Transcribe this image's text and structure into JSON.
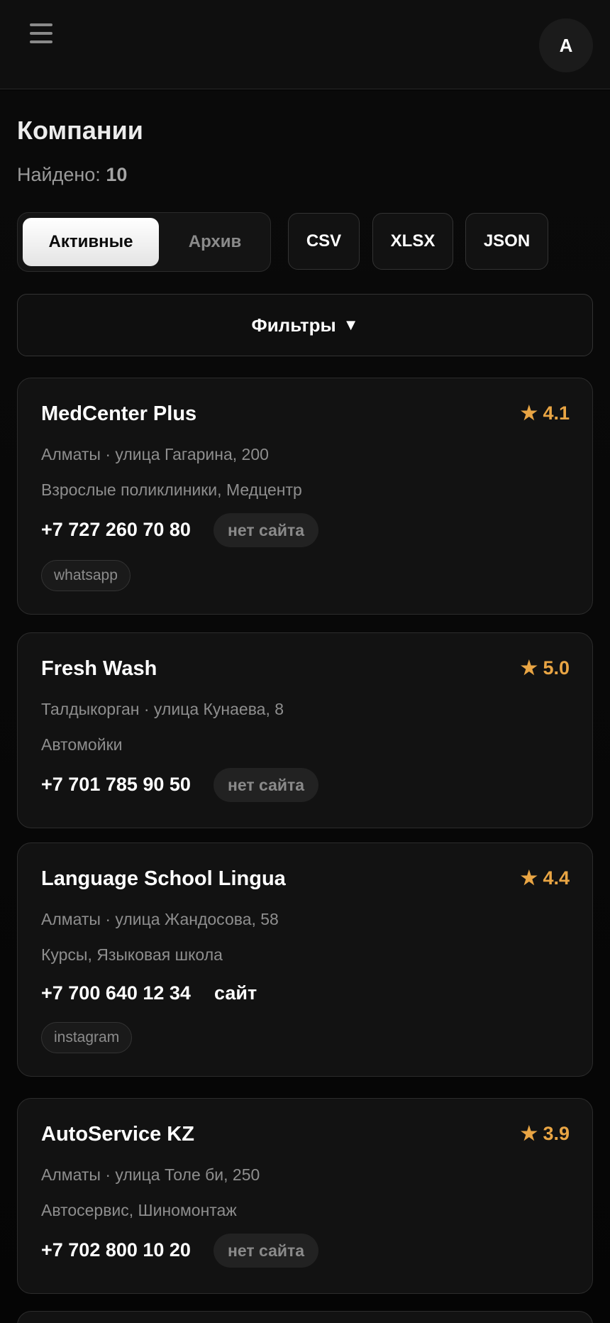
{
  "header": {
    "avatar_initial": "A",
    "menu_icon": "hamburger-menu-icon"
  },
  "page": {
    "title": "Компании",
    "found_label": "Найдено:",
    "found_count": "10"
  },
  "tabs": {
    "active": "Активные",
    "archive": "Архив"
  },
  "export": {
    "csv": "CSV",
    "xlsx": "XLSX",
    "json": "JSON"
  },
  "filters": {
    "label": "Фильтры",
    "arrow": "▼"
  },
  "accent_color": "#e9a544",
  "companies": [
    {
      "name": "MedCenter Plus",
      "rating": "★ 4.1",
      "address": "Алматы · улица Гагарина, 200",
      "categories": "Взрослые поликлиники, Медцентр",
      "phone": "+7 727 260 70 80",
      "site": "нет сайта",
      "tag": "whatsapp"
    },
    {
      "name": "Fresh Wash",
      "rating": "★ 5.0",
      "address": "Талдыкорган · улица Кунаева, 8",
      "categories": "Автомойки",
      "phone": "+7 701 785 90 50",
      "site": "нет сайта"
    },
    {
      "name": "Language School Lingua",
      "rating": "★ 4.4",
      "address": "Алматы · улица Жандосова, 58",
      "categories": "Курсы, Языковая школа",
      "phone": "+7 700 640 12 34",
      "site": "сайт",
      "tag": "instagram"
    },
    {
      "name": "AutoService KZ",
      "rating": "★ 3.9",
      "address": "Алматы · улица Толе би, 250",
      "categories": "Автосервис, Шиномонтаж",
      "phone": "+7 702 800 10 20",
      "site": "нет сайта"
    }
  ]
}
